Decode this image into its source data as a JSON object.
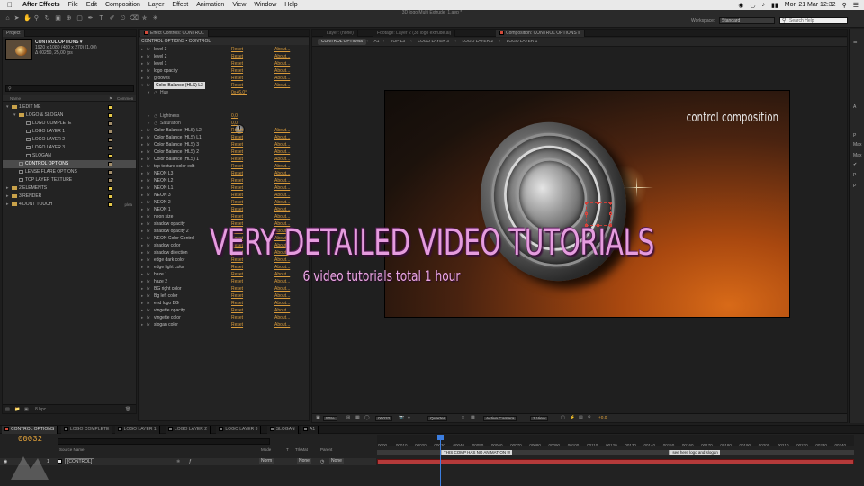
{
  "menubar": {
    "app_name": "After Effects",
    "items": [
      "File",
      "Edit",
      "Composition",
      "Layer",
      "Effect",
      "Animation",
      "View",
      "Window",
      "Help"
    ],
    "clock": "Mon 21 Mar  12:32"
  },
  "toolbar": {
    "doc_title": "3D logo Multi Extrude_1.aep *",
    "workspace_label": "Workspace:",
    "workspace_value": "Standard",
    "search_placeholder": "Search Help"
  },
  "project": {
    "tab": "Project",
    "item_name": "CONTROL OPTIONS ▾",
    "item_size": "1920 x 1080 (480 x 270) (1,00)",
    "item_duration": "Δ 00250, 25,00 fps",
    "columns": {
      "name": "Name",
      "comment": "Commen"
    },
    "rows": [
      {
        "name": "1 EDIT ME",
        "indent": 0,
        "type": "folder",
        "label": "#e7c94a",
        "kind": "",
        "selected": false,
        "twirl": "▾"
      },
      {
        "name": "LOGO & SLOGAN",
        "indent": 1,
        "type": "folder",
        "label": "#e7c94a",
        "kind": "",
        "selected": false,
        "twirl": "▾"
      },
      {
        "name": "LOGO COMPLETE",
        "indent": 2,
        "type": "comp",
        "label": "#a48f6b",
        "kind": "",
        "selected": false,
        "twirl": ""
      },
      {
        "name": "LOGO LAYER 1",
        "indent": 2,
        "type": "comp",
        "label": "#a48f6b",
        "kind": "",
        "selected": false,
        "twirl": ""
      },
      {
        "name": "LOGO LAYER 2",
        "indent": 2,
        "type": "comp",
        "label": "#a48f6b",
        "kind": "",
        "selected": false,
        "twirl": ""
      },
      {
        "name": "LOGO LAYER 3",
        "indent": 2,
        "type": "comp",
        "label": "#a48f6b",
        "kind": "",
        "selected": false,
        "twirl": ""
      },
      {
        "name": "SLOGAN",
        "indent": 2,
        "type": "comp",
        "label": "#e7c94a",
        "kind": "",
        "selected": false,
        "twirl": ""
      },
      {
        "name": "CONTROL OPTIONS",
        "indent": 1,
        "type": "comp",
        "label": "#a48f6b",
        "kind": "",
        "selected": true,
        "twirl": ""
      },
      {
        "name": "LENSE FLARE OPTIONS",
        "indent": 1,
        "type": "comp",
        "label": "#a48f6b",
        "kind": "",
        "selected": false,
        "twirl": ""
      },
      {
        "name": "TOP LAYER TEXTURE",
        "indent": 1,
        "type": "comp",
        "label": "#a48f6b",
        "kind": "",
        "selected": false,
        "twirl": ""
      },
      {
        "name": "2 ELEMENTS",
        "indent": 0,
        "type": "folder",
        "label": "#e7c94a",
        "kind": "",
        "selected": false,
        "twirl": "▸"
      },
      {
        "name": "3 RENDER",
        "indent": 0,
        "type": "folder",
        "label": "#e7c94a",
        "kind": "",
        "selected": false,
        "twirl": "▸"
      },
      {
        "name": "4 DONT TOUCH",
        "indent": 0,
        "type": "folder",
        "label": "#e7c94a",
        "kind": "plea",
        "selected": false,
        "twirl": "▸"
      }
    ],
    "footer_bpc": "8 bpc"
  },
  "effects": {
    "tab": "Effect Controls: CONTROL",
    "header": "CONTROL OPTIONS • CONTROL",
    "reset": "Reset",
    "about": "About...",
    "rows": [
      {
        "name": "level 3",
        "kind": "fx"
      },
      {
        "name": "level 2",
        "kind": "fx"
      },
      {
        "name": "level 1",
        "kind": "fx"
      },
      {
        "name": "logo opacity",
        "kind": "fx"
      },
      {
        "name": "grooves",
        "kind": "fx"
      },
      {
        "name": "Color Balance (HLS) L3",
        "kind": "fx-open"
      },
      {
        "name": "Hue",
        "kind": "prop",
        "value": "0x+6,0°"
      },
      {
        "name": "",
        "kind": "dial"
      },
      {
        "name": "",
        "kind": "spacer"
      },
      {
        "name": "Lightness",
        "kind": "prop",
        "value": "0,0"
      },
      {
        "name": "Saturation",
        "kind": "prop",
        "value": "0,0"
      },
      {
        "name": "Color Balance (HLS) L2",
        "kind": "fx"
      },
      {
        "name": "Color Balance (HLS) L1",
        "kind": "fx"
      },
      {
        "name": "Color Balance (HLS) 3",
        "kind": "fx"
      },
      {
        "name": "Color Balance (HLS) 2",
        "kind": "fx"
      },
      {
        "name": "Color Balance (HLS) 1",
        "kind": "fx"
      },
      {
        "name": "top texture color edit",
        "kind": "fx"
      },
      {
        "name": "NEON L3",
        "kind": "fx"
      },
      {
        "name": "NEON L2",
        "kind": "fx"
      },
      {
        "name": "NEON L1",
        "kind": "fx"
      },
      {
        "name": "NEON 3",
        "kind": "fx"
      },
      {
        "name": "NEON 2",
        "kind": "fx"
      },
      {
        "name": "NEON 1",
        "kind": "fx"
      },
      {
        "name": "neon size",
        "kind": "fx"
      },
      {
        "name": "shadow opacity",
        "kind": "fx"
      },
      {
        "name": "shadow opacity 2",
        "kind": "fx"
      },
      {
        "name": "NEON Color Control",
        "kind": "fx"
      },
      {
        "name": "shadow color",
        "kind": "fx"
      },
      {
        "name": "shadow direction",
        "kind": "fx"
      },
      {
        "name": "edge dark color",
        "kind": "fx"
      },
      {
        "name": "edge light color",
        "kind": "fx"
      },
      {
        "name": "haze 1",
        "kind": "fx"
      },
      {
        "name": "haze 2",
        "kind": "fx"
      },
      {
        "name": "BG right color",
        "kind": "fx"
      },
      {
        "name": "Bg left color",
        "kind": "fx"
      },
      {
        "name": "end logo BG",
        "kind": "fx"
      },
      {
        "name": "vingette opacity",
        "kind": "fx"
      },
      {
        "name": "vingette color",
        "kind": "fx"
      },
      {
        "name": "slogan color",
        "kind": "fx"
      }
    ]
  },
  "comp": {
    "tabs": [
      "Layer: (none)",
      "Footage: Layer 2 (3d logo extrude.ai)",
      "Composition: CONTROL OPTIONS ≡"
    ],
    "breadcrumbs": [
      "CONTROL OPTIONS",
      "A1",
      "TOP L3",
      "LOGO LAYER 3",
      "LOGO LAYER 2",
      "LOGO LAYER 1"
    ],
    "viewer_title": "control composition",
    "footer": {
      "zoom": "50%",
      "timecode": "00032",
      "resolution": "Quarter",
      "camera": "Active Camera",
      "views": "1 View",
      "exposure": "+0,0"
    }
  },
  "overlay": {
    "headline": "VERY DETAILED VIDEO TUTORIALS",
    "subline": "6 video tutorials  total 1 hour"
  },
  "right_strip": {
    "items": [
      "A",
      "P",
      "Max",
      "Max",
      "✔",
      "P",
      "P"
    ]
  },
  "timeline": {
    "tabs": [
      "CONTROL OPTIONS",
      "LOGO COMPLETE",
      "LOGO LAYER 1",
      "LOGO LAYER 2",
      "LOGO LAYER 3",
      "SLOGAN",
      "A1"
    ],
    "current_time": "00032",
    "columns": {
      "source": "Source Name",
      "mode": "Mode",
      "t": "T",
      "trkmat": "TrkMat",
      "parent": "Parent"
    },
    "layer": {
      "index": "1",
      "name": "[CONTROL]",
      "mode": "Norm",
      "trkmat": "None",
      "parent": "None"
    },
    "ticks": [
      "0000",
      "00010",
      "00020",
      "00030",
      "00040",
      "00050",
      "00060",
      "00070",
      "00080",
      "00090",
      "00100",
      "00110",
      "00120",
      "00130",
      "00140",
      "00150",
      "00160",
      "00170",
      "00180",
      "00190",
      "00200",
      "00210",
      "00220",
      "00230",
      "00240"
    ],
    "markers": [
      {
        "text": "THIS COMP HAS NO ANIMATION !!!",
        "frame": 0
      },
      {
        "text": "see here logo and slogan",
        "frame": 120
      }
    ]
  },
  "colors": {
    "accent_orange": "#e0a13a",
    "label_yellow": "#e7c94a",
    "overlay_pink": "#e59cde",
    "layer_bar": "#b43a3a",
    "playhead": "#3c7ee0"
  }
}
